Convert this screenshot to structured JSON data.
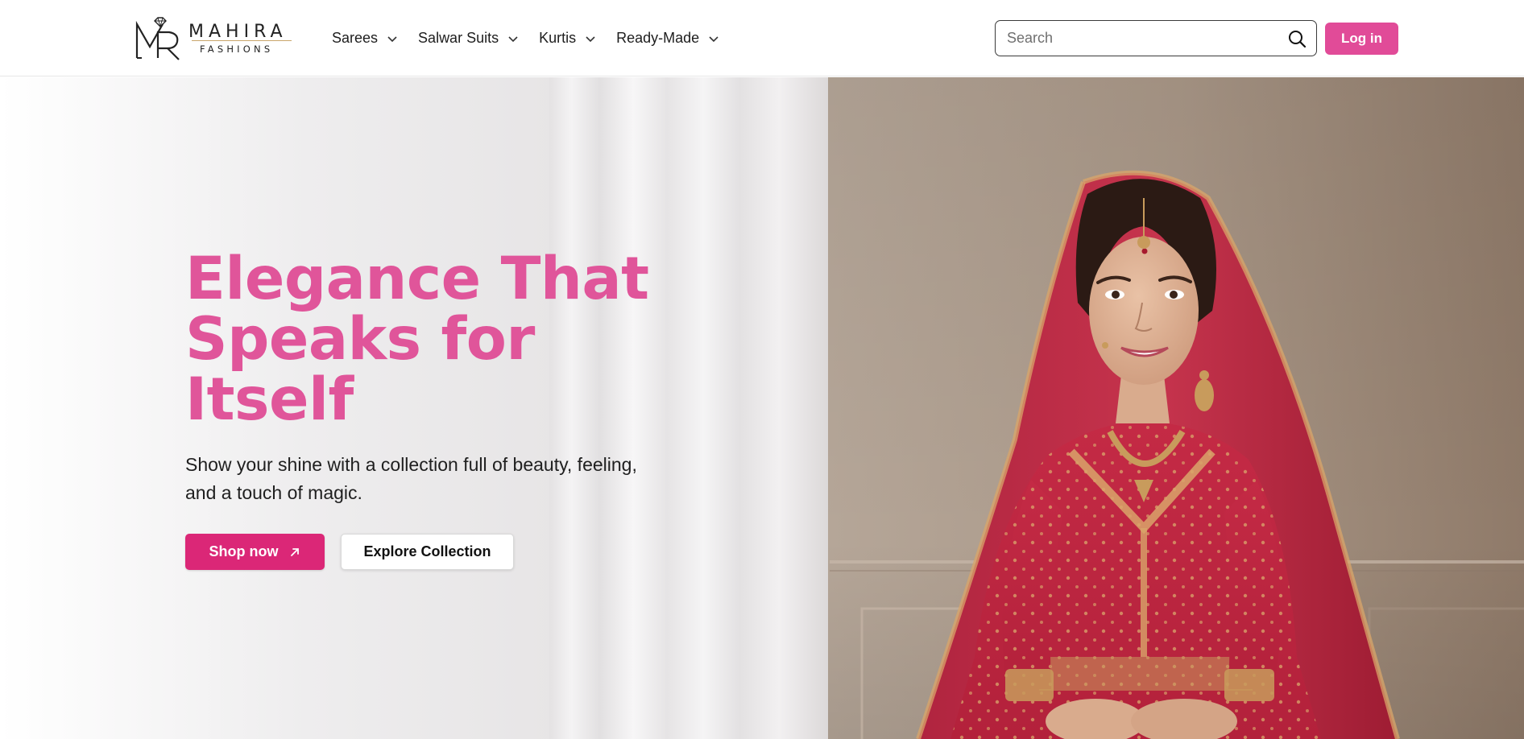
{
  "brand": {
    "name": "MAHIRA",
    "tagline": "FASHIONS"
  },
  "nav": {
    "items": [
      {
        "label": "Sarees",
        "icon": "chevron-down-icon"
      },
      {
        "label": "Salwar Suits",
        "icon": "chevron-down-icon"
      },
      {
        "label": "Kurtis",
        "icon": "chevron-down-icon"
      },
      {
        "label": "Ready-Made",
        "icon": "chevron-down-icon"
      }
    ]
  },
  "search": {
    "placeholder": "Search",
    "value": "",
    "icon": "search-icon"
  },
  "header": {
    "login_label": "Log in"
  },
  "hero": {
    "title": "Elegance That Speaks for Itself",
    "subtitle": "Show your shine with a collection full of beauty, feeling, and a touch of magic.",
    "primary_cta": "Shop now",
    "primary_cta_icon": "arrow-up-right-icon",
    "secondary_cta": "Explore Collection"
  },
  "colors": {
    "accent_pink": "#e14b98",
    "title_pink": "#e0559a",
    "cta_pink": "#db2777",
    "dress_red": "#b8223a",
    "gold": "#c9a66b"
  }
}
